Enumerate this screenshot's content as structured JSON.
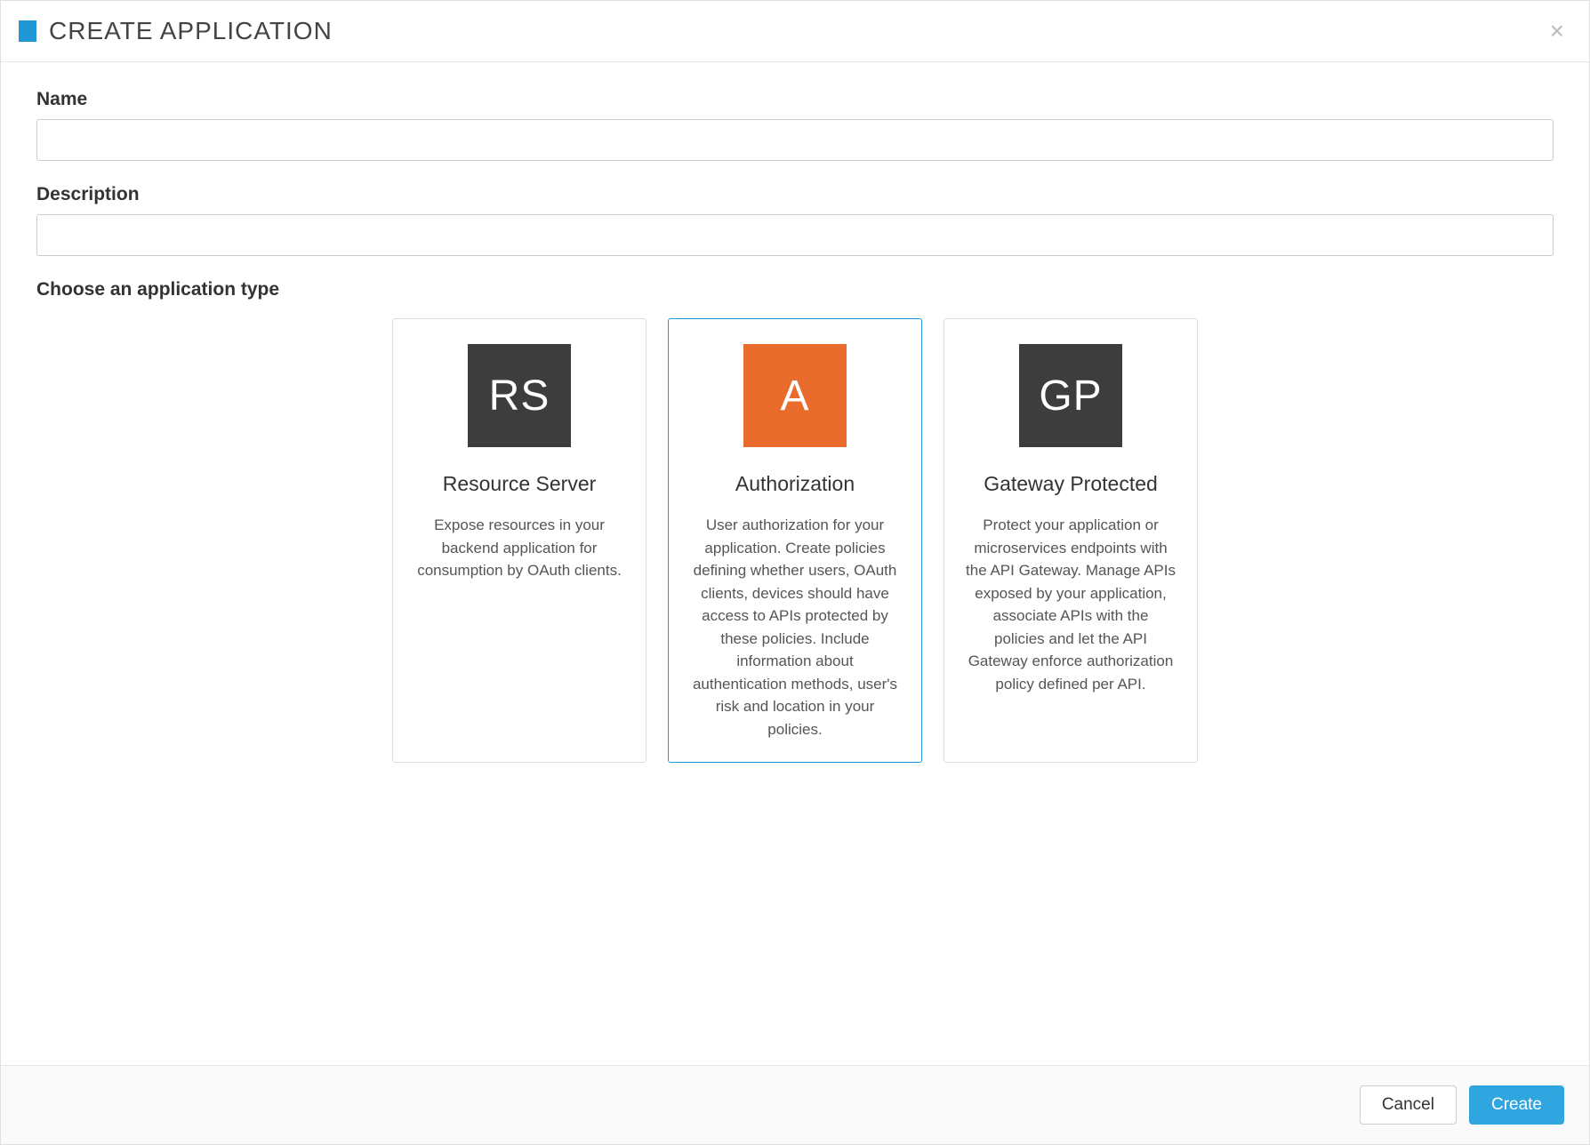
{
  "header": {
    "title": "CREATE APPLICATION"
  },
  "form": {
    "name_label": "Name",
    "name_value": "",
    "description_label": "Description",
    "description_value": "",
    "type_section_label": "Choose an application type"
  },
  "types": [
    {
      "icon_text": "RS",
      "title": "Resource Server",
      "description": "Expose resources in your backend application for consumption by OAuth clients.",
      "selected": false,
      "icon_style": "dark"
    },
    {
      "icon_text": "A",
      "title": "Authorization",
      "description": "User authorization for your application. Create policies defining whether users, OAuth clients, devices should have access to APIs protected by these policies. Include information about authentication methods, user's risk and location in your policies.",
      "selected": true,
      "icon_style": "orange"
    },
    {
      "icon_text": "GP",
      "title": "Gateway Protected",
      "description": "Protect your application or microservices endpoints with the API Gateway. Manage APIs exposed by your application, associate APIs with the policies and let the API Gateway enforce authorization policy defined per API.",
      "selected": false,
      "icon_style": "dark"
    }
  ],
  "footer": {
    "cancel_label": "Cancel",
    "create_label": "Create"
  }
}
